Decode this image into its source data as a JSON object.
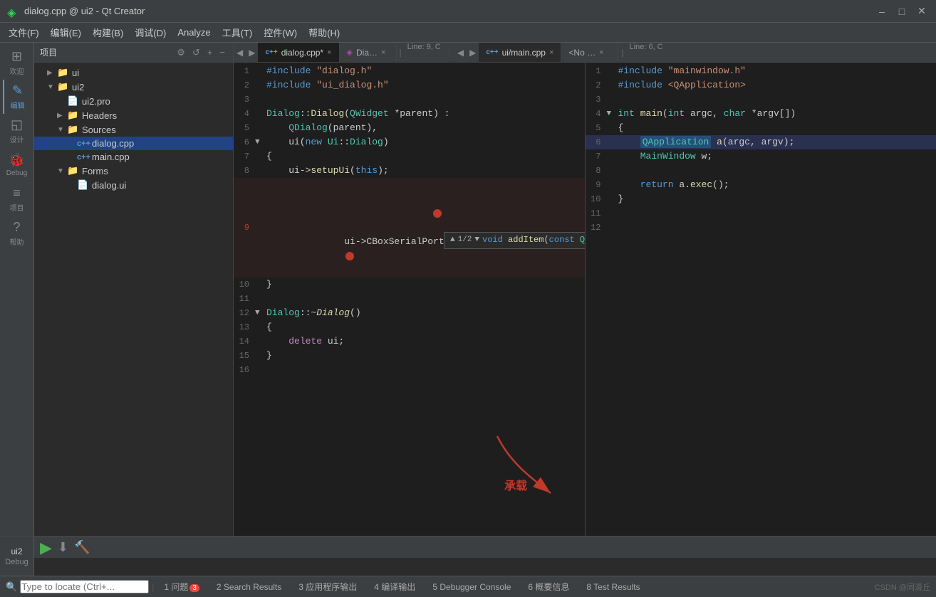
{
  "titlebar": {
    "title": "dialog.cpp @ ui2 - Qt Creator",
    "icon": "qt-icon",
    "minimize": "–",
    "maximize": "□",
    "close": "✕"
  },
  "menubar": {
    "items": [
      "文件(F)",
      "编辑(E)",
      "构建(B)",
      "调试(D)",
      "Analyze",
      "工具(T)",
      "控件(W)",
      "帮助(H)"
    ]
  },
  "sidebar": {
    "items": [
      {
        "id": "welcome",
        "icon": "⊞",
        "label": "欢迎"
      },
      {
        "id": "edit",
        "icon": "✎",
        "label": "编辑",
        "active": true
      },
      {
        "id": "design",
        "icon": "◱",
        "label": "设计"
      },
      {
        "id": "debug",
        "icon": "⑁",
        "label": "Debug"
      },
      {
        "id": "project",
        "icon": "≡",
        "label": "项目"
      },
      {
        "id": "help",
        "icon": "?",
        "label": "帮助"
      }
    ]
  },
  "project_panel": {
    "title": "项目",
    "tree": [
      {
        "indent": 1,
        "arrow": "▶",
        "icon": "📁",
        "label": "ui",
        "type": "folder"
      },
      {
        "indent": 1,
        "arrow": "▼",
        "icon": "📁",
        "label": "ui2",
        "type": "folder",
        "expanded": true
      },
      {
        "indent": 2,
        "arrow": "",
        "icon": "📄",
        "label": "ui2.pro",
        "type": "file"
      },
      {
        "indent": 2,
        "arrow": "▶",
        "icon": "📁",
        "label": "Headers",
        "type": "folder"
      },
      {
        "indent": 2,
        "arrow": "▼",
        "icon": "📁",
        "label": "Sources",
        "type": "folder",
        "expanded": true
      },
      {
        "indent": 3,
        "arrow": "",
        "icon": "·",
        "label": "dialog.cpp",
        "type": "cpp",
        "selected": true
      },
      {
        "indent": 3,
        "arrow": "",
        "icon": "·",
        "label": "main.cpp",
        "type": "cpp"
      },
      {
        "indent": 2,
        "arrow": "▼",
        "icon": "📁",
        "label": "Forms",
        "type": "folder",
        "expanded": true
      },
      {
        "indent": 3,
        "arrow": "",
        "icon": "📄",
        "label": "dialog.ui",
        "type": "ui"
      }
    ]
  },
  "editor": {
    "tabs": [
      {
        "label": "dialog.cpp*",
        "active": true,
        "close": "×"
      },
      {
        "label": "Dia…",
        "close": "×"
      },
      {
        "label": "ui/main.cpp",
        "close": "×"
      },
      {
        "label": "<No …",
        "close": "×"
      }
    ],
    "left_pane": {
      "header": "dialog.cpp*",
      "line_col": "Line: 9, C",
      "lines": [
        {
          "num": 1,
          "code": "#include \"dialog.h\""
        },
        {
          "num": 2,
          "code": "#include \"ui_dialog.h\""
        },
        {
          "num": 3,
          "code": ""
        },
        {
          "num": 4,
          "code": "Dialog::Dialog(QWidget *parent) :"
        },
        {
          "num": 5,
          "code": "    QDialog(parent),"
        },
        {
          "num": 6,
          "code": "    ui(new Ui::Dialog)",
          "arrow": "▼"
        },
        {
          "num": 7,
          "code": "{"
        },
        {
          "num": 8,
          "code": "    ui->setupUi(this);"
        },
        {
          "num": 9,
          "code": "    ui->CBoxSerialPort->addItem()",
          "marker": "circle",
          "highlight_word": "addItem"
        },
        {
          "num": 10,
          "code": "}"
        },
        {
          "num": 11,
          "code": ""
        },
        {
          "num": 12,
          "code": "Dialog::~Dialog()",
          "arrow": "▼"
        },
        {
          "num": 13,
          "code": "{"
        },
        {
          "num": 14,
          "code": "    delete ui;"
        },
        {
          "num": 15,
          "code": "}"
        },
        {
          "num": 16,
          "code": ""
        }
      ]
    },
    "right_pane": {
      "header": "ui/main.cpp",
      "line_col": "Line: 6, C",
      "lines": [
        {
          "num": 1,
          "code": "#include \"mainwindow.h\""
        },
        {
          "num": 2,
          "code": "#include <QApplication>"
        },
        {
          "num": 3,
          "code": ""
        },
        {
          "num": 4,
          "code": "int main(int argc, char *argv[])",
          "arrow": "▼"
        },
        {
          "num": 5,
          "code": "{"
        },
        {
          "num": 6,
          "code": "    QApplication a(argc, argv);"
        },
        {
          "num": 7,
          "code": "    MainWindow w;"
        },
        {
          "num": 8,
          "code": ""
        },
        {
          "num": 9,
          "code": "    return a.exec();"
        },
        {
          "num": 10,
          "code": "}"
        },
        {
          "num": 11,
          "code": ""
        },
        {
          "num": 12,
          "code": ""
        }
      ]
    },
    "autocomplete": {
      "counter": "1/2",
      "signature": "void addItem(const QString &atext,  const QVariant &auserData = Q"
    }
  },
  "annotation": {
    "text": "承载",
    "arrow_color": "#c0392b"
  },
  "bottom_toolbar": {
    "locate_placeholder": "Type to locate (Ctrl+...",
    "tabs": [
      {
        "num": 1,
        "label": "问题",
        "badge": "3",
        "badge_type": "error"
      },
      {
        "num": 2,
        "label": "Search Results"
      },
      {
        "num": 3,
        "label": "应用程序输出"
      },
      {
        "num": 4,
        "label": "编译输出"
      },
      {
        "num": 5,
        "label": "Debugger Console"
      },
      {
        "num": 6,
        "label": "概要信息"
      },
      {
        "num": 8,
        "label": "Test Results"
      }
    ]
  },
  "bottom_sidebar": {
    "label": "ui2",
    "debug_label": "Debug",
    "icons": [
      "▶",
      "⬇"
    ]
  },
  "watermark": "CSDN @同滑丘"
}
